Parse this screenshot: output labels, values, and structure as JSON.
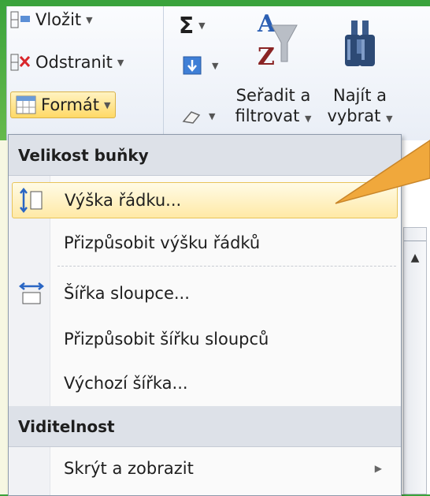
{
  "ribbon": {
    "insert_label": "Vložit",
    "delete_label": "Odstranit",
    "format_label": "Formát",
    "sum_symbol": "Σ",
    "sort_label_1": "Seřadit a",
    "sort_label_2": "filtrovat",
    "find_label_1": "Najít a",
    "find_label_2": "vybrat"
  },
  "menu": {
    "cell_size_header": "Velikost buňky",
    "visibility_header": "Viditelnost",
    "items": [
      {
        "label": "Výška řádku..."
      },
      {
        "label": "Přizpůsobit výšku řádků"
      },
      {
        "label": "Šířka sloupce..."
      },
      {
        "label": "Přizpůsobit šířku sloupců"
      },
      {
        "label": "Výchozí šířka..."
      },
      {
        "label": "Skrýt a zobrazit"
      }
    ]
  },
  "colors": {
    "frame_green": "#3aa33c",
    "highlight": "#ffe9a6",
    "callout": "#f0a83c"
  }
}
